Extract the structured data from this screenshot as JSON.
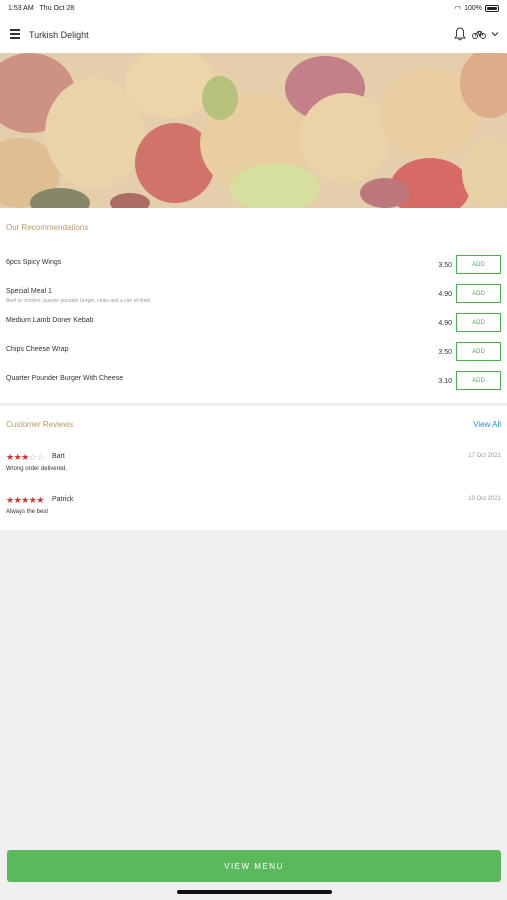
{
  "status_bar": {
    "time": "1:53 AM",
    "date": "Thu Oct 28",
    "battery": "100%"
  },
  "header": {
    "title": "Turkish Delight"
  },
  "icons": {
    "menu": "hamburger-menu-icon",
    "notifications": "bell-icon",
    "delivery": "bicycle-icon",
    "expand": "chevron-down-icon"
  },
  "recommendations": {
    "title": "Our Recommendations",
    "add_label": "ADD",
    "items": [
      {
        "name": "6pcs Spicy Wings",
        "description": "",
        "price": "3.50"
      },
      {
        "name": "Special Meal 1",
        "description": "Beef or chicken, quarter pounder burger, chips and a can of drink",
        "price": "4.90"
      },
      {
        "name": "Medium Lamb Doner Kebab",
        "description": "",
        "price": "4.90"
      },
      {
        "name": "Chips Cheese Wrap",
        "description": "",
        "price": "3.50"
      },
      {
        "name": "Quarter Pounder Burger With Cheese",
        "description": "",
        "price": "3.10"
      }
    ]
  },
  "reviews": {
    "title": "Customer Reviews",
    "view_all": "View All",
    "items": [
      {
        "reviewer": "Bart",
        "rating": 3,
        "max_rating": 5,
        "date": "17 Oct 2021",
        "text": "Wrong order delivered."
      },
      {
        "reviewer": "Patrick",
        "rating": 5,
        "max_rating": 5,
        "date": "10 Oct 2021",
        "text": "Always the best"
      }
    ]
  },
  "footer": {
    "view_menu": "VIEW MENU"
  },
  "colors": {
    "accent_green": "#5cb85c",
    "section_title": "#b59a6a",
    "link_blue": "#2a8fc7",
    "star_red": "#d9302a"
  }
}
